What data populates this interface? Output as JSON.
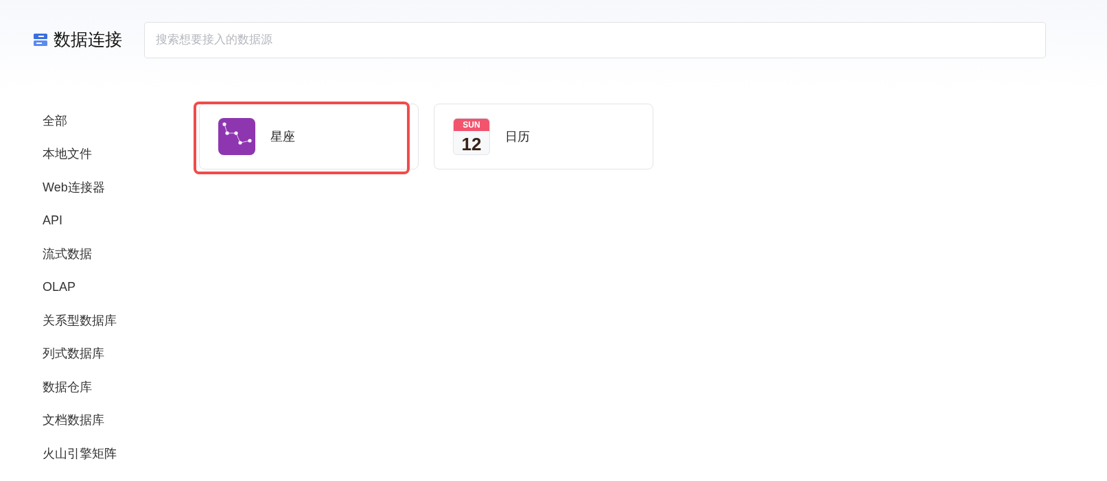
{
  "header": {
    "title": "数据连接",
    "search": {
      "placeholder": "搜索想要接入的数据源"
    }
  },
  "sidebar": {
    "items": [
      {
        "label": "全部"
      },
      {
        "label": "本地文件"
      },
      {
        "label": "Web连接器"
      },
      {
        "label": "API"
      },
      {
        "label": "流式数据"
      },
      {
        "label": "OLAP"
      },
      {
        "label": "关系型数据库"
      },
      {
        "label": "列式数据库"
      },
      {
        "label": "数据仓库"
      },
      {
        "label": "文档数据库"
      },
      {
        "label": "火山引擎矩阵"
      }
    ]
  },
  "cards": [
    {
      "kind": "constellation",
      "label": "星座",
      "selected": true
    },
    {
      "kind": "calendar",
      "label": "日历",
      "selected": false,
      "day": "SUN",
      "date": "12"
    }
  ]
}
